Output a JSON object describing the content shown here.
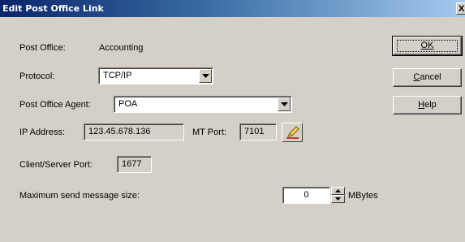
{
  "window": {
    "title": "Edit Post Office Link",
    "close_label": "X"
  },
  "post_office": {
    "label": "Post Office:",
    "value": "Accounting"
  },
  "protocol": {
    "label": "Protocol:",
    "value": "TCP/IP"
  },
  "poa": {
    "label": "Post Office Agent:",
    "value": "POA"
  },
  "ip": {
    "label": "IP Address:",
    "value": "123.45.678.136"
  },
  "mt_port": {
    "label": "MT Port:",
    "value": "7101"
  },
  "cs_port": {
    "label": "Client/Server Port:",
    "value": "1677"
  },
  "max_send": {
    "label": "Maximum send message size:",
    "value": "0",
    "unit": "MBytes"
  },
  "buttons": {
    "ok": {
      "underline": "",
      "rest": "OK",
      "label": "OK"
    },
    "cancel": {
      "underline": "C",
      "rest": "ancel",
      "label": "Cancel"
    },
    "help": {
      "underline": "H",
      "rest": "elp",
      "label": "Help"
    }
  },
  "icons": {
    "dropdown": "chevron-down-icon",
    "edit": "pencil-icon",
    "spin_up": "arrow-up-icon",
    "spin_down": "arrow-down-icon"
  }
}
